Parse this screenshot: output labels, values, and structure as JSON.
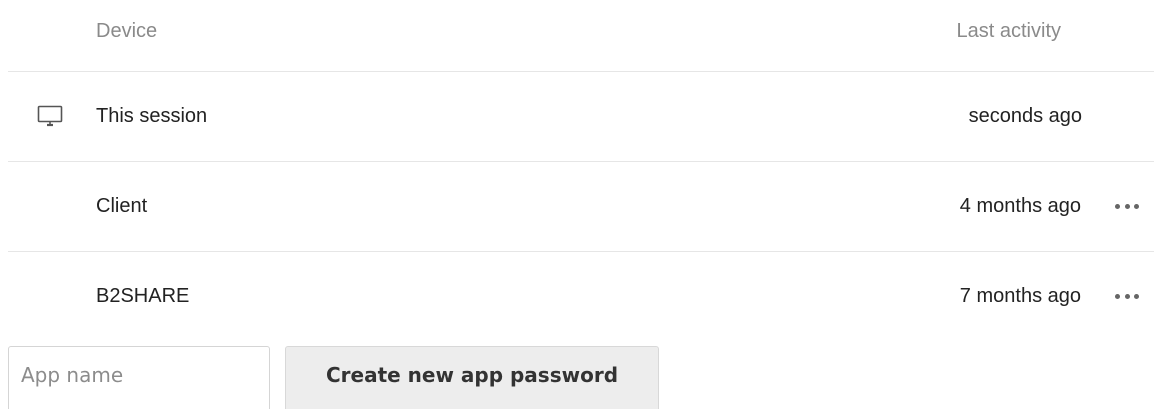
{
  "table": {
    "headers": {
      "device": "Device",
      "last_activity": "Last activity"
    },
    "rows": [
      {
        "name": "This session",
        "last_activity": "seconds ago",
        "icon": "monitor-icon",
        "has_menu": false
      },
      {
        "name": "Client",
        "last_activity": "4 months ago",
        "icon": null,
        "has_menu": true
      },
      {
        "name": "B2SHARE",
        "last_activity": "7 months ago",
        "icon": null,
        "has_menu": true
      }
    ]
  },
  "form": {
    "input_placeholder": "App name",
    "input_value": "",
    "create_button_label": "Create new app password"
  },
  "colors": {
    "header_text": "#8a8a8a",
    "body_text": "#222222",
    "divider": "#e6e6e6",
    "button_bg": "#ededed"
  }
}
